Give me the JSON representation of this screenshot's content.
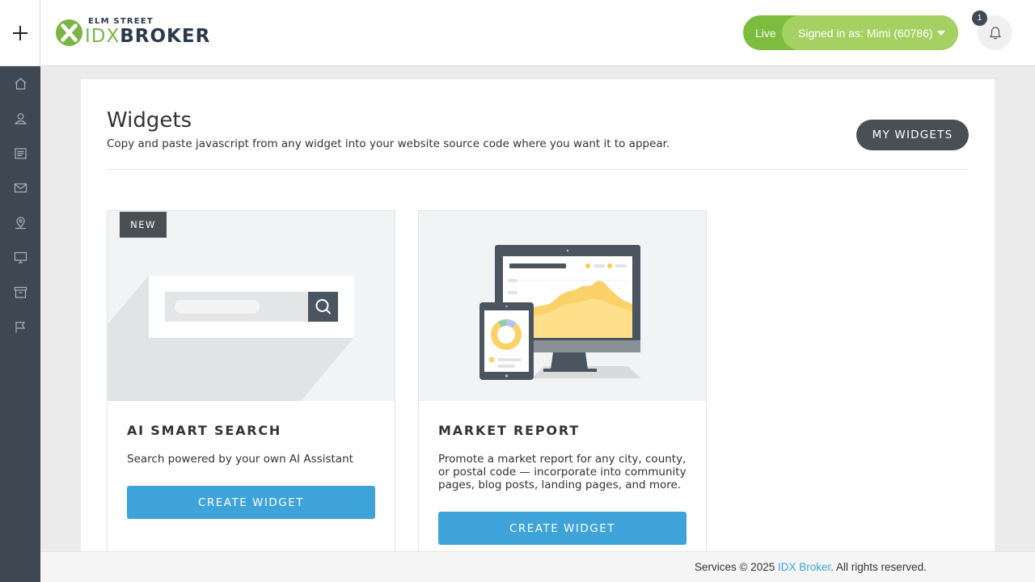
{
  "header": {
    "logo_top": "ELM STREET",
    "logo_idx": "IDX",
    "logo_broker": "BROKER",
    "live_label": "Live",
    "signed_in_label": "Signed in as: Mimi (60786)",
    "notification_count": "1",
    "accent_green": "#7cbc3f",
    "accent_light_green": "#a4d162"
  },
  "sidebar": {
    "items": [
      {
        "icon": "home-icon"
      },
      {
        "icon": "user-icon"
      },
      {
        "icon": "listings-icon"
      },
      {
        "icon": "mail-icon"
      },
      {
        "icon": "map-pin-icon"
      },
      {
        "icon": "monitor-icon"
      },
      {
        "icon": "archive-icon"
      },
      {
        "icon": "flag-icon"
      }
    ]
  },
  "main": {
    "title": "Widgets",
    "subtitle": "Copy and paste javascript from any widget into your website source code where you want it to appear.",
    "my_widgets_label": "MY WIDGETS",
    "cards": [
      {
        "badge": "NEW",
        "title": "AI SMART SEARCH",
        "description": "Search powered by your own AI Assistant",
        "button_label": "CREATE WIDGET"
      },
      {
        "title": "MARKET REPORT",
        "description": "Promote a market report for any city, county, or postal code — incorporate into community pages, blog posts, landing pages, and more.",
        "button_label": "CREATE WIDGET"
      }
    ],
    "button_color": "#3da3d8"
  },
  "footer": {
    "prefix": "Services © 2025 ",
    "link_text": "IDX Broker",
    "suffix": ". All rights reserved."
  }
}
